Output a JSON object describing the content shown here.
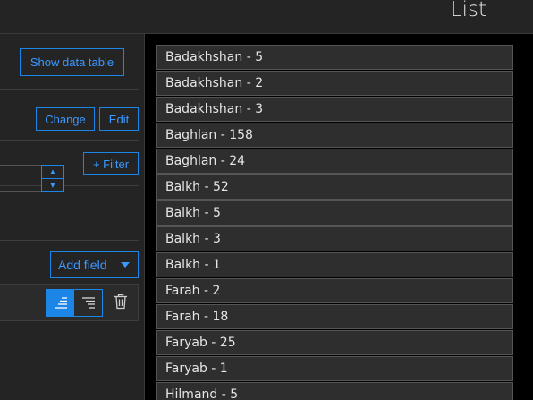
{
  "header": {
    "title": "List"
  },
  "panel": {
    "show_data_table": "Show data table",
    "change": "Change",
    "edit": "Edit",
    "filter": "+ Filter",
    "add_field": "Add field"
  },
  "colors": {
    "accent": "#1c85e8",
    "panel_bg": "#242424",
    "page_bg": "#000000"
  },
  "list": {
    "items": [
      "Badakhshan - 5",
      "Badakhshan - 2",
      "Badakhshan - 3",
      "Baghlan - 158",
      "Baghlan - 24",
      "Balkh - 52",
      "Balkh - 5",
      "Balkh - 3",
      "Balkh - 1",
      "Farah - 2",
      "Farah - 18",
      "Faryab - 25",
      "Faryab - 1",
      "Hilmand - 5"
    ]
  }
}
